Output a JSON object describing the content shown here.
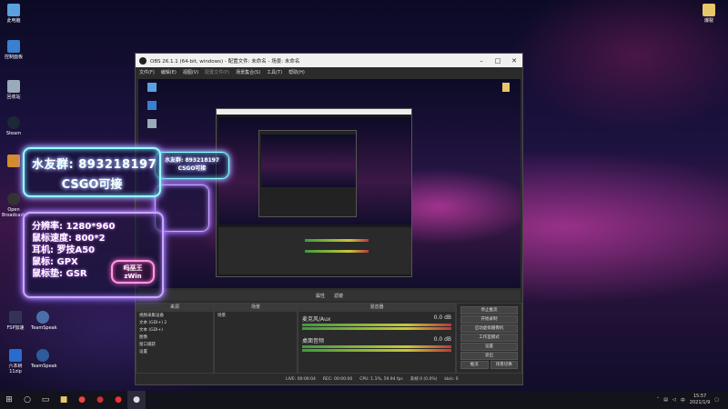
{
  "desktop_icons_left": [
    {
      "label": "此电脑",
      "icon": "pc-icon"
    },
    {
      "label": "控制面板",
      "icon": "control-panel-icon"
    },
    {
      "label": "回收站",
      "icon": "recycle-bin-icon"
    },
    {
      "label": "Steam",
      "icon": "steam-icon"
    },
    {
      "label": "",
      "icon": "app-icon"
    },
    {
      "label": "Open Broadcaster",
      "icon": "obs-icon"
    },
    {
      "label": "",
      "icon": "app-icon"
    },
    {
      "label": "",
      "icon": "app-icon"
    },
    {
      "label": "",
      "icon": "app-icon"
    }
  ],
  "desktop_icons_bottom": [
    {
      "label": "FSP加速",
      "icon": "game-icon"
    },
    {
      "label": "TeamSpeak",
      "icon": "headset-icon"
    },
    {
      "label": "六本树11zip",
      "icon": "archive-icon"
    },
    {
      "label": "TeamSpeak",
      "icon": "teamspeak-icon"
    }
  ],
  "desktop_icon_right": {
    "label": "爆裂",
    "icon": "folder-icon"
  },
  "overlay": {
    "group_text": "水友群: 893218197",
    "csgo_text": "CSGO可接",
    "specs": [
      "分辨率: 1280*960",
      "鼠标速度: 800*2",
      "耳机: 罗技A50",
      "鼠标: GPX",
      "鼠标垫: GSR"
    ],
    "badge_top": "吗巫王",
    "badge_bottom": "zWin"
  },
  "obs": {
    "title": "OBS 26.1.1 (64-bit, windows) - 配置文件: 未命名 - 场景: 未命名",
    "menu": [
      "文件(F)",
      "编辑(E)",
      "视图(V)",
      "配置文件(P)",
      "场景集合(S)",
      "工具(T)",
      "帮助(H)"
    ],
    "scene_bar": [
      "属性",
      "滤镜"
    ],
    "docks": {
      "sources_title": "场景",
      "scenes_title": "来源",
      "mixer_title": "混音器",
      "controls_title": "控件"
    },
    "sources": [
      "视频采集设备",
      "文本 (GDI+) 2",
      "文本 (GDI+)",
      "图像",
      "窗口捕获",
      "设置"
    ],
    "scene_items": [
      "场景"
    ],
    "mixer": [
      {
        "name": "麦克风/Aux",
        "level": "0.0 dB"
      },
      {
        "name": "桌面音频",
        "level": "0.0 dB"
      }
    ],
    "controls": [
      "停止推流",
      "开始录制",
      "启动虚拟摄像机",
      "工作室模式",
      "设置",
      "退出"
    ],
    "stream_buttons": [
      "推流",
      "场景切换"
    ],
    "status": {
      "live": "LIVE: 00:00:04",
      "rec": "REC: 00:00:00",
      "cpu": "CPU: 1.1%, 59.94 fps",
      "drop": "丢帧 0 (0.0%)",
      "bitrate": "kb/s: 0"
    }
  },
  "taskbar": {
    "apps": [
      "start-icon",
      "search-icon",
      "task-view-icon",
      "file-explorer-icon",
      "chrome-icon",
      "app-icon",
      "app-icon",
      "obs-icon"
    ],
    "tray_lang": "中",
    "time": "15:57",
    "date": "2021/1/9"
  },
  "colors": {
    "neon_cyan": "#99ffff",
    "neon_purple": "#c8a8ff",
    "obs_bg": "#2b2b2b"
  }
}
